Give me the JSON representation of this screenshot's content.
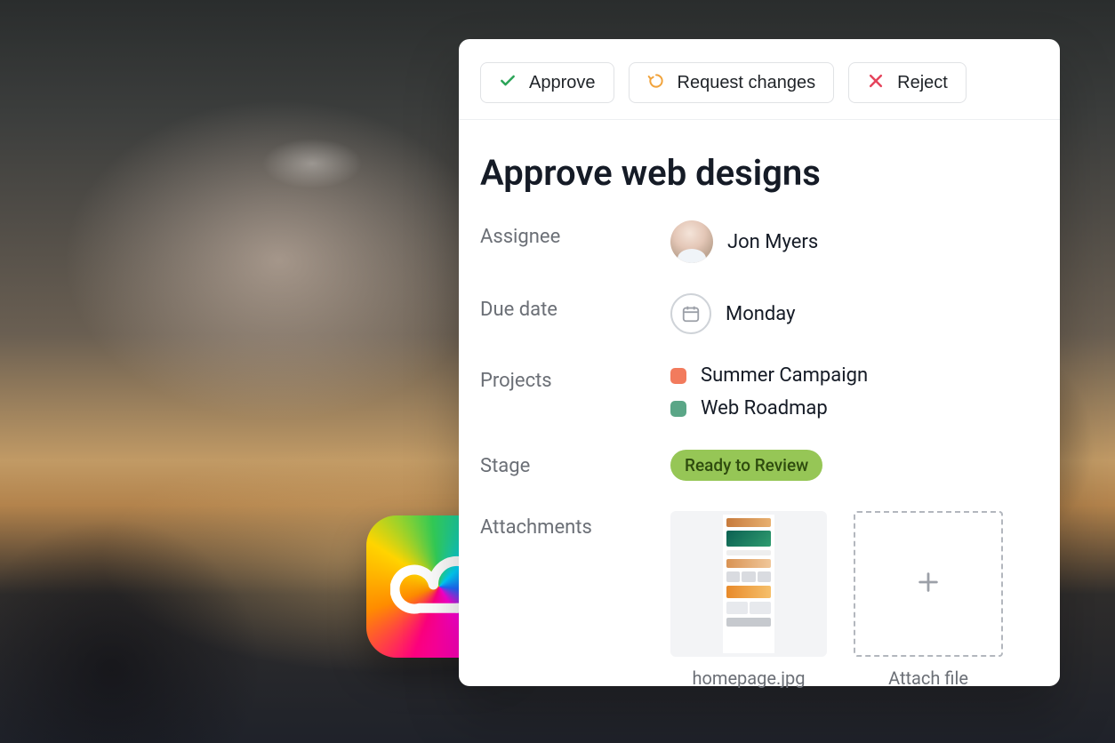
{
  "toolbar": {
    "approve_label": "Approve",
    "request_changes_label": "Request changes",
    "reject_label": "Reject"
  },
  "task": {
    "title": "Approve web designs",
    "labels": {
      "assignee": "Assignee",
      "due_date": "Due date",
      "projects": "Projects",
      "stage": "Stage",
      "attachments": "Attachments"
    },
    "assignee": {
      "name": "Jon Myers"
    },
    "due_date": "Monday",
    "projects": [
      {
        "name": "Summer Campaign",
        "color": "#f27b5d"
      },
      {
        "name": "Web Roadmap",
        "color": "#5aa687"
      }
    ],
    "stage": "Ready to Review",
    "attachments": {
      "existing": {
        "filename": "homepage.jpg"
      },
      "add_label": "Attach file"
    }
  },
  "icons": {
    "creative_cloud": "adobe-creative-cloud-icon"
  }
}
